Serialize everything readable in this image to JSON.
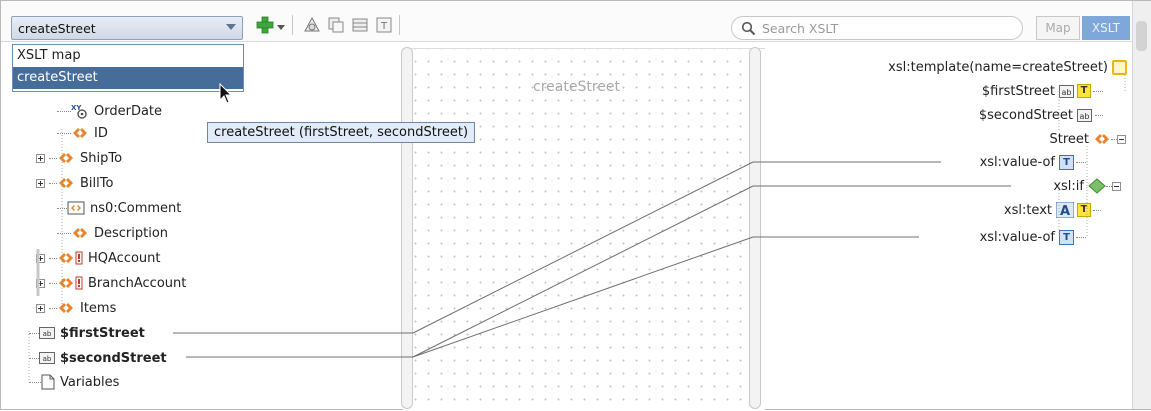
{
  "toolbar": {
    "template_selector_value": "createStreet",
    "search_placeholder": "Search XSLT",
    "mode_map_label": "Map",
    "mode_xslt_label": "XSLT"
  },
  "dropdown": {
    "options": [
      "XSLT map",
      "createStreet"
    ],
    "selected": "createStreet"
  },
  "tooltip": "createStreet (firstStreet, secondStreet)",
  "source_tree": {
    "items": [
      {
        "label": "OrderDate",
        "icon": "xy-attribute-icon"
      },
      {
        "label": "ID",
        "icon": "element-icon"
      },
      {
        "label": "ShipTo",
        "icon": "element-icon",
        "expandable": true
      },
      {
        "label": "BillTo",
        "icon": "element-icon",
        "expandable": true
      },
      {
        "label": "ns0:Comment",
        "icon": "comment-element-icon"
      },
      {
        "label": "Description",
        "icon": "element-icon"
      },
      {
        "label": "HQAccount",
        "icon": "choice-element-icon",
        "expandable": true
      },
      {
        "label": "BranchAccount",
        "icon": "choice-element-icon",
        "expandable": true
      },
      {
        "label": "Items",
        "icon": "element-icon",
        "expandable": true
      },
      {
        "label": "$firstStreet",
        "icon": "param-icon"
      },
      {
        "label": "$secondStreet",
        "icon": "param-icon"
      },
      {
        "label": "Variables",
        "icon": "document-icon"
      }
    ]
  },
  "canvas": {
    "label": "createStreet"
  },
  "target_tree": {
    "items": [
      {
        "label": "xsl:template(name=createStreet)",
        "icon": "template-icon"
      },
      {
        "label": "$firstStreet",
        "icon": "param-text-icon"
      },
      {
        "label": "$secondStreet",
        "icon": "param-icon"
      },
      {
        "label": "Street",
        "icon": "element-icon"
      },
      {
        "label": "xsl:value-of",
        "icon": "text-node-icon"
      },
      {
        "label": "xsl:if",
        "icon": "if-diamond-icon"
      },
      {
        "label": "xsl:text",
        "icon": "xsl-text-icon"
      },
      {
        "label": "xsl:value-of",
        "icon": "text-node-icon"
      }
    ]
  },
  "colors": {
    "selection": "#466c9a",
    "accent": "#7fa7da",
    "element_icon": "#e8832a"
  }
}
